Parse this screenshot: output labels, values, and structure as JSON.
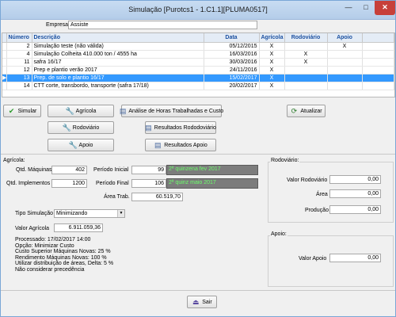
{
  "window": {
    "title": "Simulação    [Purotcs1 - 1.C1.1][PLUMA0517]",
    "minimize": "—",
    "maximize": "□",
    "close": "✕"
  },
  "empresa": {
    "label": "Empresa",
    "value": "Assiste"
  },
  "grid": {
    "headers": [
      "Número",
      "Descrição",
      "Data",
      "Agrícola",
      "Rodoviário",
      "Apoio"
    ],
    "rows": [
      {
        "indicator": "",
        "numero": "2",
        "descricao": "Simulação teste (não válida)",
        "data": "05/12/2015",
        "agricola": "X",
        "rodoviario": "",
        "apoio": "X",
        "selected": false
      },
      {
        "indicator": "",
        "numero": "4",
        "descricao": "Simulação Colheita 410.000 ton / 4555 ha",
        "data": "16/03/2016",
        "agricola": "X",
        "rodoviario": "X",
        "apoio": "",
        "selected": false
      },
      {
        "indicator": "",
        "numero": "11",
        "descricao": "safra 16/17",
        "data": "30/03/2016",
        "agricola": "X",
        "rodoviario": "X",
        "apoio": "",
        "selected": false
      },
      {
        "indicator": "",
        "numero": "12",
        "descricao": "Prep e plantio verão 2017",
        "data": "24/11/2016",
        "agricola": "X",
        "rodoviario": "",
        "apoio": "",
        "selected": false
      },
      {
        "indicator": "▶",
        "numero": "13",
        "descricao": "Prep. de solo e plantio 16/17",
        "data": "15/02/2017",
        "agricola": "X",
        "rodoviario": "",
        "apoio": "",
        "selected": true
      },
      {
        "indicator": "",
        "numero": "14",
        "descricao": "CTT corte, transbordo, transporte (safra 17/18)",
        "data": "20/02/2017",
        "agricola": "X",
        "rodoviario": "",
        "apoio": "",
        "selected": false
      }
    ]
  },
  "buttons": {
    "simular": "Simular",
    "agricola": "Agrícola",
    "rodoviario": "Rodoviário",
    "apoio": "Apoio",
    "analise": "Análise de Horas Trabalhadas e Custo",
    "resultados_rodoviario": "Resultados Rododoviário",
    "resultados_apoio": "Resultados Apoio",
    "atualizar": "Atualizar",
    "sair": "Sair"
  },
  "agricola": {
    "section_label": "Agrícola:",
    "qtd_maquinas_label": "Qtd. Máquinas",
    "qtd_maquinas": "402",
    "qtd_implementos_label": "Qtd. Implementos",
    "qtd_implementos": "1200",
    "periodo_inicial_label": "Período Inicial",
    "periodo_inicial": "99",
    "periodo_inicial_desc": "2ª quinzena fev 2017",
    "periodo_final_label": "Período Final",
    "periodo_final": "106",
    "periodo_final_desc": "2ª quinz maio 2017",
    "area_trab_label": "Área Trab.",
    "area_trab": "60.519,70",
    "tipo_simulacao_label": "Tipo Simulação",
    "tipo_simulacao": "Minimizando",
    "valor_agricola_label": "Valor Agrícola",
    "valor_agricola": "6.911.059,36",
    "info": [
      "Processado: 17/02/2017 14:00",
      "Opção: Minimizar Custo",
      "Custo Superior Máquinas Novas: 25 %",
      "Rendimento Máquinas Novas: 100 %",
      "Utilizar distribuição de áreas, Delta: 5 %",
      "Não considerar precedência"
    ]
  },
  "rodoviario": {
    "section_label": "Rodoviário:",
    "valor_label": "Valor Rodoviário",
    "valor": "0,00",
    "area_label": "Área",
    "area": "0,00",
    "producao_label": "Produção",
    "producao": "0,00"
  },
  "apoio": {
    "section_label": "Apoio:",
    "valor_label": "Valor Apoio",
    "valor": "0,00"
  },
  "icons": {
    "check": "✔",
    "wrench": "🔧",
    "doc": "▤",
    "refresh": "⟳",
    "exit": "⏏"
  }
}
